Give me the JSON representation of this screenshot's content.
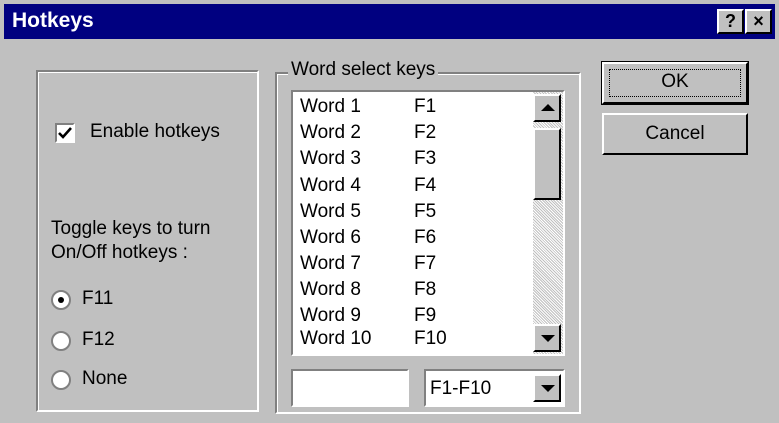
{
  "window": {
    "title": "Hotkeys",
    "help_label": "?",
    "close_label": "×"
  },
  "options": {
    "enable_label": "Enable hotkeys",
    "enable_checked": true,
    "toggle_label_line1": "Toggle keys to turn",
    "toggle_label_line2": "On/Off hotkeys :",
    "radios": [
      {
        "label": "F11",
        "selected": true
      },
      {
        "label": "F12",
        "selected": false
      },
      {
        "label": "None",
        "selected": false
      }
    ]
  },
  "word_select": {
    "legend": "Word select keys",
    "rows": [
      {
        "word": "Word 1",
        "key": "F1"
      },
      {
        "word": "Word 2",
        "key": "F2"
      },
      {
        "word": "Word 3",
        "key": "F3"
      },
      {
        "word": "Word 4",
        "key": "F4"
      },
      {
        "word": "Word 5",
        "key": "F5"
      },
      {
        "word": "Word 6",
        "key": "F6"
      },
      {
        "word": "Word 7",
        "key": "F7"
      },
      {
        "word": "Word 8",
        "key": "F8"
      },
      {
        "word": "Word 9",
        "key": "F9"
      },
      {
        "word": "Word 10",
        "key": "F10"
      }
    ],
    "word_input_value": "",
    "key_select_value": "F1-F10"
  },
  "buttons": {
    "ok_label": "OK",
    "cancel_label": "Cancel"
  }
}
